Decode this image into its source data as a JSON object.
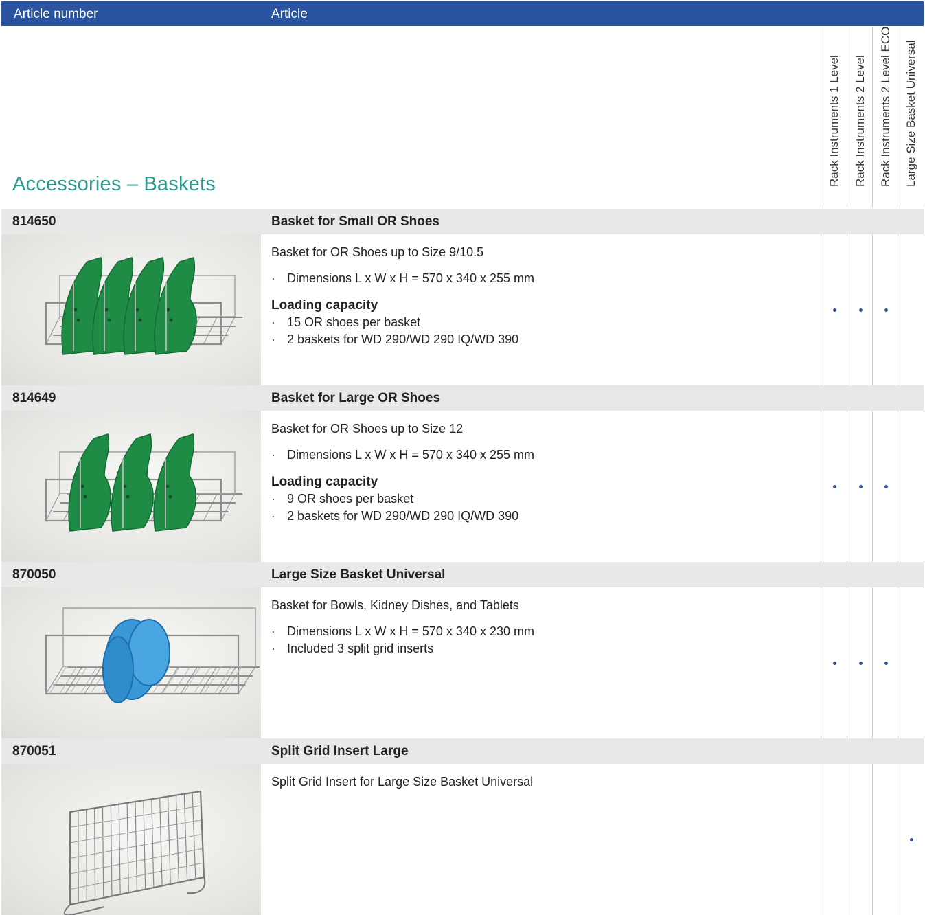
{
  "header": {
    "article_number_label": "Article number",
    "article_label": "Article"
  },
  "section_title": "Accessories – Baskets",
  "compat_columns": [
    "Rack Instruments 1 Level",
    "Rack Instruments 2 Level",
    "Rack Instruments 2 Level ECO",
    "Large Size Basket Universal"
  ],
  "colors": {
    "header_bar": "#2b54a0",
    "section_title": "#2a9a8c",
    "row_band": "#e8e8e8",
    "mark": "#2b54a0"
  },
  "products": [
    {
      "number": "814650",
      "name": "Basket for Small OR Shoes",
      "intro": "Basket for OR Shoes up to Size 9/10.5",
      "bullets": [
        "Dimensions L x W x H = 570 x 340 x 255 mm"
      ],
      "capacity_title": "Loading capacity",
      "capacity": [
        "15 OR shoes per basket",
        "2 baskets for WD 290/WD 290 IQ/WD 390"
      ],
      "compat": [
        true,
        true,
        true,
        false
      ],
      "image": "green-shoe-basket-4"
    },
    {
      "number": "814649",
      "name": "Basket for Large OR Shoes",
      "intro": "Basket for OR Shoes up to Size 12",
      "bullets": [
        "Dimensions L x W x H = 570 x 340 x 255 mm"
      ],
      "capacity_title": "Loading capacity",
      "capacity": [
        "9 OR shoes per basket",
        "2 baskets for WD 290/WD 290 IQ/WD 390"
      ],
      "compat": [
        true,
        true,
        true,
        false
      ],
      "image": "green-shoe-basket-3"
    },
    {
      "number": "870050",
      "name": "Large Size Basket Universal",
      "intro": "Basket for Bowls, Kidney Dishes, and Tablets",
      "bullets": [
        "Dimensions L x W x H = 570 x 340 x 230 mm",
        "Included 3 split grid inserts"
      ],
      "capacity_title": "",
      "capacity": [],
      "compat": [
        true,
        true,
        true,
        false
      ],
      "image": "wire-basket-blue-dishes"
    },
    {
      "number": "870051",
      "name": "Split Grid Insert Large",
      "intro": "Split Grid Insert for Large Size Basket Universal",
      "bullets": [],
      "capacity_title": "",
      "capacity": [],
      "compat": [
        false,
        false,
        false,
        true
      ],
      "image": "split-grid-insert"
    }
  ]
}
